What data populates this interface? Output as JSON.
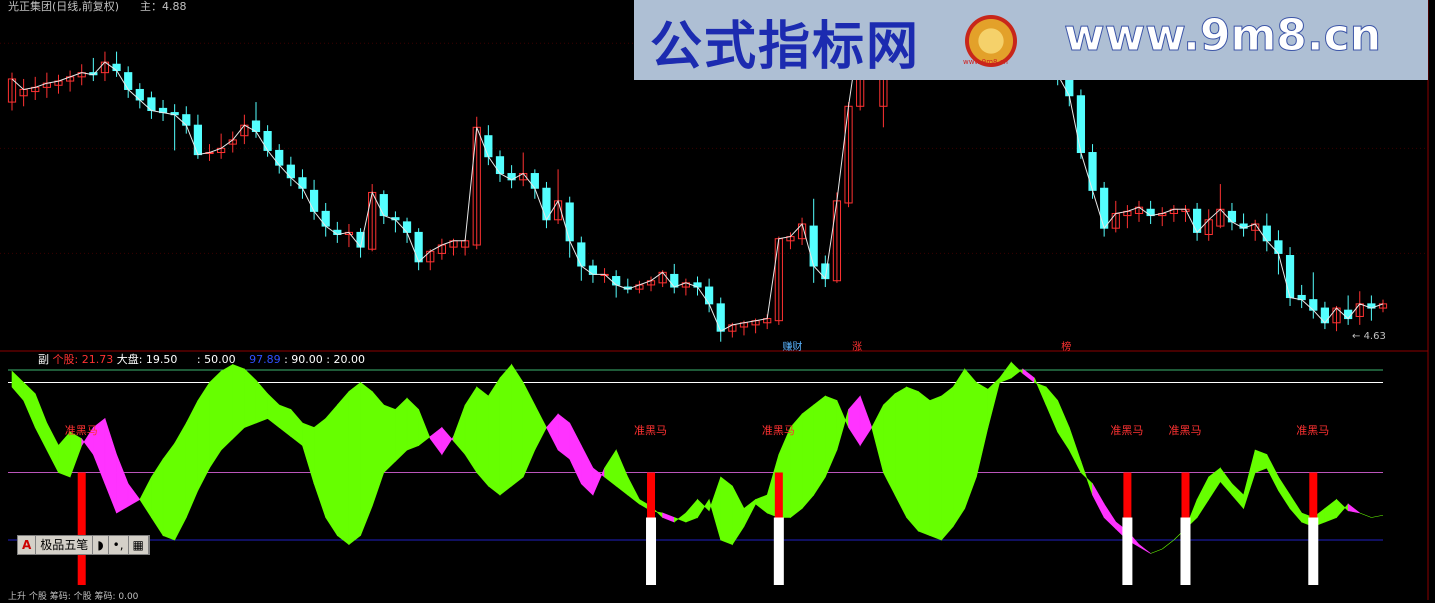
{
  "header": {
    "title": "光正集团(日线,前复权)",
    "main_label": "主：4.88"
  },
  "banner": {
    "title": "公式指标网",
    "url": "www.9m8.cn",
    "logo_text": "www.9m8.cn"
  },
  "sub_header": {
    "prefix": "副",
    "stock_label": "个股: 21.73",
    "market_label": "大盘: 19.50",
    "v1": ": 50.00",
    "v2": "97.89",
    "v3": ": 90.00 : 20.00"
  },
  "event_labels": [
    "赚财",
    "涨",
    "榜"
  ],
  "low_label": "4.63",
  "signal_label": "准黑马",
  "ime": {
    "a": "A",
    "name": "极品五笔",
    "moon": "◗",
    "punct": "•,",
    "kbd": "▦"
  },
  "footer": "上升 个股 筹码: 个股 筹码: 0.00",
  "colors": {
    "up": "#ff3232",
    "down": "#54ffff",
    "green_fill": "#66ff00",
    "magenta_fill": "#ff33ff",
    "stock_text": "#ff3232",
    "market_text": "#ffffff",
    "v2_text": "#3050ff",
    "level90": "#ffffff",
    "level_top": "#3cb371",
    "level50": "#bb55bb",
    "level20": "#2020c0"
  },
  "chart_data": [
    {
      "type": "candlestick",
      "title": "光正集团(日线,前复权)",
      "ohlc": [
        [
          5.72,
          5.86,
          5.83,
          5.68
        ],
        [
          5.75,
          5.83,
          5.78,
          5.7
        ],
        [
          5.77,
          5.84,
          5.79,
          5.73
        ],
        [
          5.79,
          5.86,
          5.81,
          5.74
        ],
        [
          5.8,
          5.85,
          5.82,
          5.76
        ],
        [
          5.82,
          5.87,
          5.84,
          5.77
        ],
        [
          5.84,
          5.9,
          5.86,
          5.8
        ],
        [
          5.86,
          5.93,
          5.85,
          5.82
        ],
        [
          5.86,
          5.96,
          5.91,
          5.82
        ],
        [
          5.9,
          5.96,
          5.87,
          5.84
        ],
        [
          5.86,
          5.89,
          5.78,
          5.74
        ],
        [
          5.78,
          5.81,
          5.73,
          5.69
        ],
        [
          5.74,
          5.77,
          5.68,
          5.64
        ],
        [
          5.69,
          5.73,
          5.67,
          5.63
        ],
        [
          5.67,
          5.71,
          5.66,
          5.49
        ],
        [
          5.66,
          5.7,
          5.61,
          5.57
        ],
        [
          5.61,
          5.66,
          5.47,
          5.45
        ],
        [
          5.48,
          5.52,
          5.48,
          5.44
        ],
        [
          5.48,
          5.57,
          5.5,
          5.45
        ],
        [
          5.52,
          5.58,
          5.54,
          5.48
        ],
        [
          5.56,
          5.66,
          5.61,
          5.52
        ],
        [
          5.63,
          5.72,
          5.58,
          5.55
        ],
        [
          5.58,
          5.61,
          5.49,
          5.46
        ],
        [
          5.49,
          5.52,
          5.42,
          5.38
        ],
        [
          5.42,
          5.46,
          5.36,
          5.32
        ],
        [
          5.36,
          5.4,
          5.31,
          5.26
        ],
        [
          5.3,
          5.35,
          5.2,
          5.16
        ],
        [
          5.2,
          5.24,
          5.13,
          5.08
        ],
        [
          5.11,
          5.15,
          5.09,
          5.05
        ],
        [
          5.09,
          5.14,
          5.1,
          5.03
        ],
        [
          5.1,
          5.12,
          5.03,
          4.98
        ],
        [
          5.02,
          5.33,
          5.29,
          5.01
        ],
        [
          5.28,
          5.3,
          5.18,
          5.14
        ],
        [
          5.17,
          5.2,
          5.16,
          5.1
        ],
        [
          5.15,
          5.17,
          5.1,
          5.05
        ],
        [
          5.1,
          5.12,
          4.96,
          4.92
        ],
        [
          4.96,
          5.02,
          5.01,
          4.92
        ],
        [
          5.0,
          5.07,
          5.04,
          4.97
        ],
        [
          5.03,
          5.07,
          5.06,
          4.99
        ],
        [
          5.03,
          5.07,
          5.06,
          4.99
        ],
        [
          5.04,
          5.65,
          5.6,
          5.02
        ],
        [
          5.56,
          5.61,
          5.46,
          5.42
        ],
        [
          5.46,
          5.49,
          5.38,
          5.34
        ],
        [
          5.38,
          5.42,
          5.35,
          5.31
        ],
        [
          5.35,
          5.48,
          5.38,
          5.32
        ],
        [
          5.38,
          5.4,
          5.31,
          5.26
        ],
        [
          5.31,
          5.34,
          5.16,
          5.12
        ],
        [
          5.16,
          5.4,
          5.25,
          5.14
        ],
        [
          5.24,
          5.27,
          5.06,
          4.98
        ],
        [
          5.05,
          5.08,
          4.94,
          4.87
        ],
        [
          4.94,
          4.97,
          4.9,
          4.86
        ],
        [
          4.9,
          4.93,
          4.9,
          4.86
        ],
        [
          4.89,
          4.92,
          4.85,
          4.79
        ],
        [
          4.84,
          4.88,
          4.83,
          4.81
        ],
        [
          4.83,
          4.87,
          4.85,
          4.81
        ],
        [
          4.85,
          4.89,
          4.87,
          4.82
        ],
        [
          4.86,
          4.92,
          4.91,
          4.84
        ],
        [
          4.9,
          4.95,
          4.84,
          4.81
        ],
        [
          4.84,
          4.88,
          4.86,
          4.8
        ],
        [
          4.86,
          4.89,
          4.84,
          4.8
        ],
        [
          4.84,
          4.88,
          4.76,
          4.72
        ],
        [
          4.76,
          4.79,
          4.63,
          4.58
        ],
        [
          4.63,
          4.67,
          4.66,
          4.6
        ],
        [
          4.65,
          4.68,
          4.67,
          4.61
        ],
        [
          4.66,
          4.69,
          4.68,
          4.62
        ],
        [
          4.67,
          4.71,
          4.69,
          4.64
        ],
        [
          4.68,
          5.08,
          5.07,
          4.66
        ],
        [
          5.06,
          5.1,
          5.08,
          5.02
        ],
        [
          5.07,
          5.17,
          5.14,
          5.04
        ],
        [
          5.13,
          5.26,
          4.94,
          4.86
        ],
        [
          4.95,
          4.99,
          4.88,
          4.84
        ],
        [
          4.87,
          5.29,
          5.25,
          4.86
        ],
        [
          5.24,
          5.72,
          5.7,
          5.22
        ],
        [
          5.7,
          6.1,
          6.08,
          5.68
        ],
        [
          6.07,
          6.12,
          6.1,
          6.03
        ],
        [
          5.7,
          6.12,
          6.08,
          5.6
        ],
        [
          6.07,
          6.12,
          6.05,
          6.0
        ],
        [
          6.04,
          6.12,
          6.09,
          5.99
        ],
        [
          6.07,
          6.12,
          6.1,
          6.03
        ],
        [
          6.09,
          6.12,
          6.03,
          5.98
        ],
        [
          6.02,
          6.1,
          6.08,
          6.0
        ],
        [
          6.07,
          6.12,
          6.1,
          6.03
        ],
        [
          6.09,
          6.12,
          6.07,
          6.03
        ],
        [
          6.06,
          6.12,
          6.09,
          6.02
        ],
        [
          6.08,
          6.12,
          6.1,
          6.04
        ],
        [
          6.08,
          6.12,
          6.1,
          6.05
        ],
        [
          6.06,
          6.12,
          6.09,
          5.98
        ],
        [
          6.08,
          6.12,
          6.11,
          6.04
        ],
        [
          6.09,
          6.12,
          6.1,
          6.05
        ],
        [
          6.1,
          6.12,
          5.99,
          5.93
        ],
        [
          5.98,
          6.03,
          5.85,
          5.8
        ],
        [
          5.85,
          5.88,
          5.75,
          5.7
        ],
        [
          5.75,
          5.78,
          5.48,
          5.45
        ],
        [
          5.48,
          5.52,
          5.3,
          5.26
        ],
        [
          5.31,
          5.34,
          5.12,
          5.08
        ],
        [
          5.12,
          5.25,
          5.19,
          5.1
        ],
        [
          5.18,
          5.23,
          5.2,
          5.12
        ],
        [
          5.19,
          5.25,
          5.22,
          5.15
        ],
        [
          5.21,
          5.25,
          5.18,
          5.14
        ],
        [
          5.18,
          5.22,
          5.19,
          5.13
        ],
        [
          5.19,
          5.23,
          5.21,
          5.15
        ],
        [
          5.2,
          5.23,
          5.21,
          5.15
        ],
        [
          5.21,
          5.24,
          5.1,
          5.06
        ],
        [
          5.09,
          5.21,
          5.16,
          5.06
        ],
        [
          5.13,
          5.33,
          5.21,
          5.12
        ],
        [
          5.2,
          5.24,
          5.15,
          5.11
        ],
        [
          5.14,
          5.19,
          5.12,
          5.08
        ],
        [
          5.11,
          5.16,
          5.14,
          5.06
        ],
        [
          5.13,
          5.19,
          5.06,
          5.01
        ],
        [
          5.06,
          5.11,
          5.0,
          4.9
        ],
        [
          4.99,
          5.03,
          4.79,
          4.75
        ],
        [
          4.8,
          4.85,
          4.78,
          4.74
        ],
        [
          4.78,
          4.91,
          4.73,
          4.69
        ],
        [
          4.74,
          4.77,
          4.67,
          4.64
        ],
        [
          4.67,
          4.75,
          4.74,
          4.63
        ],
        [
          4.73,
          4.8,
          4.69,
          4.66
        ],
        [
          4.7,
          4.82,
          4.76,
          4.66
        ],
        [
          4.76,
          4.8,
          4.74,
          4.68
        ],
        [
          4.74,
          4.78,
          4.76,
          4.72
        ]
      ],
      "ylim": [
        4.55,
        6.12
      ],
      "main_value": 4.88,
      "low_marker": 4.63
    },
    {
      "type": "area",
      "title": "副",
      "ylim": [
        0,
        100
      ],
      "levels": [
        97.89,
        90,
        50,
        20
      ],
      "series": [
        {
          "name": "个股",
          "values": [
            95,
            90,
            85,
            72,
            62,
            68,
            65,
            58,
            45,
            32,
            35,
            38,
            48,
            56,
            63,
            72,
            82,
            90,
            95,
            98,
            96,
            91,
            85,
            80,
            78,
            72,
            70,
            74,
            80,
            86,
            90,
            86,
            80,
            78,
            83,
            78,
            65,
            58,
            66,
            80,
            88,
            84,
            92,
            98,
            90,
            80,
            70,
            60,
            56,
            45,
            40,
            52,
            60,
            48,
            38,
            35,
            30,
            28,
            32,
            38,
            33,
            48,
            44,
            34,
            38,
            40,
            58,
            70,
            76,
            80,
            84,
            82,
            70,
            62,
            70,
            80,
            85,
            88,
            86,
            82,
            84,
            88,
            96,
            90,
            87,
            92,
            99,
            94,
            90,
            88,
            82,
            70,
            55,
            40,
            30,
            25,
            20,
            17,
            14,
            16,
            20,
            25,
            38,
            48,
            52,
            45,
            40,
            60,
            58,
            48,
            40,
            32,
            30,
            34,
            38,
            33,
            32,
            30,
            31,
            34,
            39
          ]
        },
        {
          "name": "大盘",
          "values": [
            88,
            82,
            70,
            60,
            50,
            48,
            62,
            70,
            74,
            58,
            45,
            38,
            30,
            22,
            20,
            30,
            42,
            52,
            60,
            65,
            70,
            72,
            74,
            70,
            66,
            62,
            45,
            30,
            22,
            18,
            22,
            35,
            50,
            55,
            60,
            62,
            66,
            70,
            64,
            58,
            50,
            44,
            40,
            44,
            48,
            60,
            70,
            76,
            72,
            62,
            52,
            48,
            44,
            40,
            36,
            33,
            32,
            30,
            28,
            30,
            38,
            20,
            18,
            26,
            36,
            32,
            30,
            30,
            34,
            40,
            48,
            60,
            78,
            84,
            70,
            50,
            40,
            30,
            24,
            22,
            20,
            26,
            34,
            48,
            70,
            90,
            92,
            96,
            92,
            80,
            68,
            60,
            50,
            45,
            36,
            28,
            24,
            18,
            14,
            16,
            20,
            25,
            30,
            38,
            46,
            40,
            34,
            50,
            52,
            42,
            34,
            28,
            26,
            28,
            30,
            36,
            32,
            30,
            31,
            34,
            38
          ]
        }
      ],
      "signals": [
        6,
        55,
        66,
        96,
        101,
        112
      ]
    }
  ]
}
